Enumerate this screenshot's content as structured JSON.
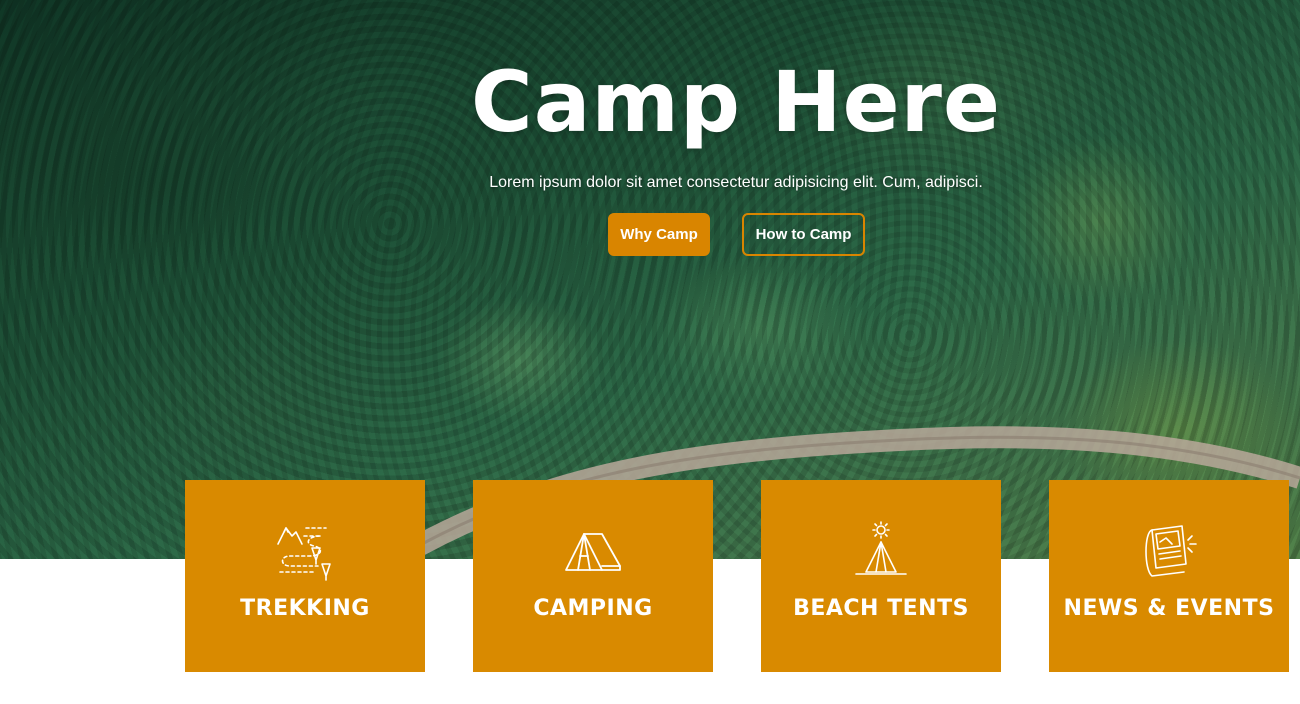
{
  "hero": {
    "title": "Camp Here",
    "subtitle": "Lorem ipsum dolor sit amet consectetur adipisicing elit. Cum, adipisci.",
    "primary_button": "Why Camp",
    "secondary_button": "How to Camp"
  },
  "cards": [
    {
      "label": "TREKKING",
      "icon": "trekking-trail-icon"
    },
    {
      "label": "CAMPING",
      "icon": "tent-icon"
    },
    {
      "label": "BEACH TENTS",
      "icon": "beach-tent-sun-icon"
    },
    {
      "label": "NEWS & EVENTS",
      "icon": "newspaper-icon"
    }
  ],
  "colors": {
    "accent": "#d98500",
    "card": "#d98a00",
    "text": "#ffffff"
  }
}
